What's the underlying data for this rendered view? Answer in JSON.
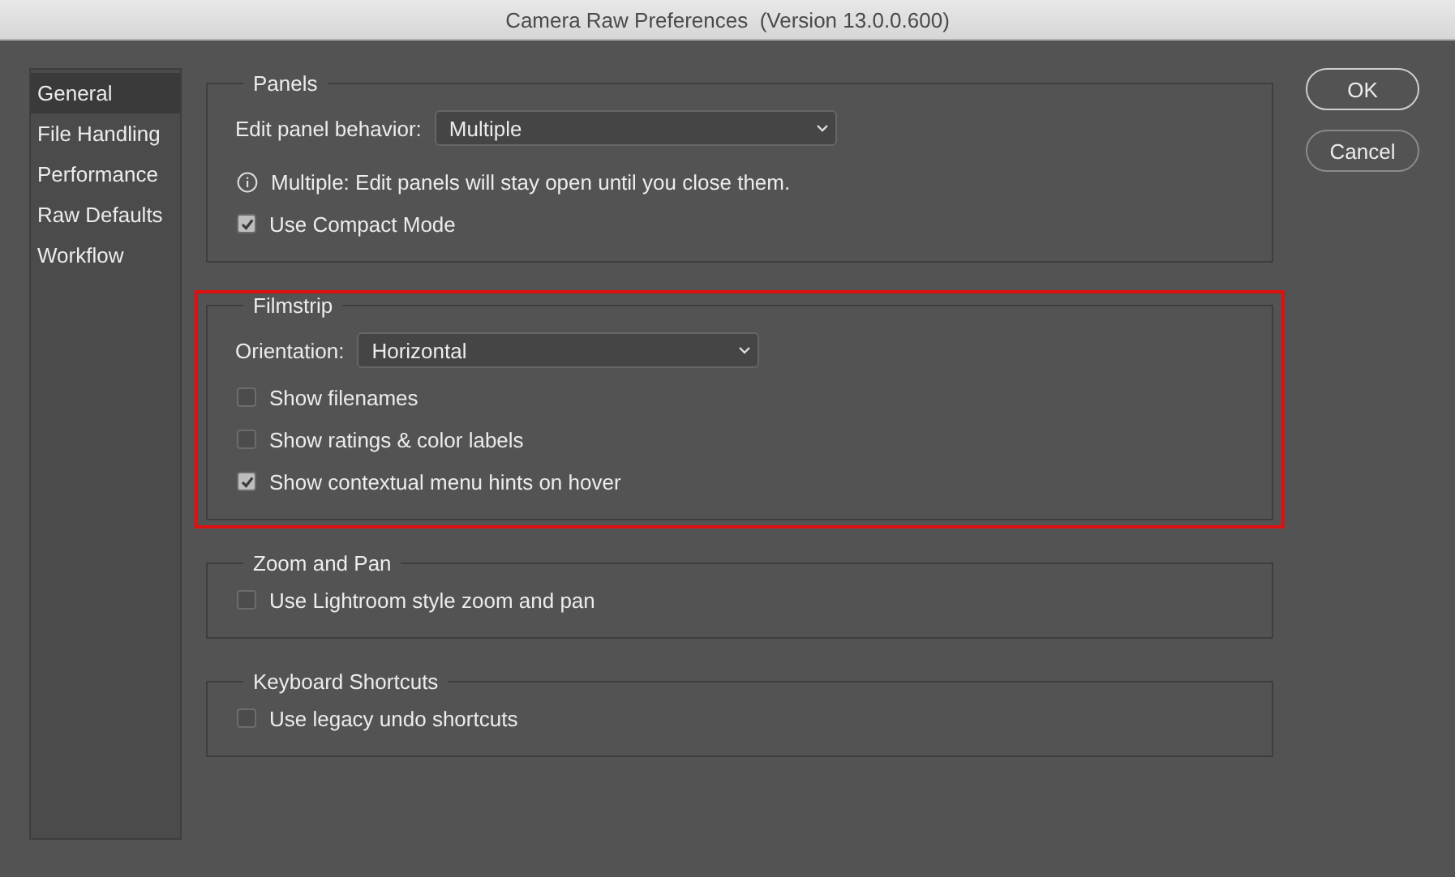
{
  "window": {
    "title": "Camera Raw Preferences  (Version 13.0.0.600)"
  },
  "sidebar": {
    "items": [
      {
        "label": "General",
        "selected": true
      },
      {
        "label": "File Handling",
        "selected": false
      },
      {
        "label": "Performance",
        "selected": false
      },
      {
        "label": "Raw Defaults",
        "selected": false
      },
      {
        "label": "Workflow",
        "selected": false
      }
    ]
  },
  "sections": [
    {
      "title": "Panels",
      "highlighted": false,
      "items": [
        {
          "kind": "dropdown",
          "label": "Edit panel behavior:",
          "value": "Multiple"
        },
        {
          "kind": "info",
          "text": "Multiple: Edit panels will stay open until you close them."
        },
        {
          "kind": "checkbox",
          "label": "Use Compact Mode",
          "checked": true
        }
      ]
    },
    {
      "title": "Filmstrip",
      "highlighted": true,
      "items": [
        {
          "kind": "dropdown",
          "label": "Orientation:",
          "value": "Horizontal"
        },
        {
          "kind": "checkbox",
          "label": "Show filenames",
          "checked": false
        },
        {
          "kind": "checkbox",
          "label": "Show ratings & color labels",
          "checked": false
        },
        {
          "kind": "checkbox",
          "label": "Show contextual menu hints on hover",
          "checked": true
        }
      ]
    },
    {
      "title": "Zoom and Pan",
      "highlighted": false,
      "items": [
        {
          "kind": "checkbox",
          "label": "Use Lightroom style zoom and pan",
          "checked": false
        }
      ]
    },
    {
      "title": "Keyboard Shortcuts",
      "highlighted": false,
      "items": [
        {
          "kind": "checkbox",
          "label": "Use legacy undo shortcuts",
          "checked": false
        }
      ]
    }
  ],
  "buttons": [
    {
      "label": "OK",
      "default": true
    },
    {
      "label": "Cancel",
      "default": false
    }
  ]
}
